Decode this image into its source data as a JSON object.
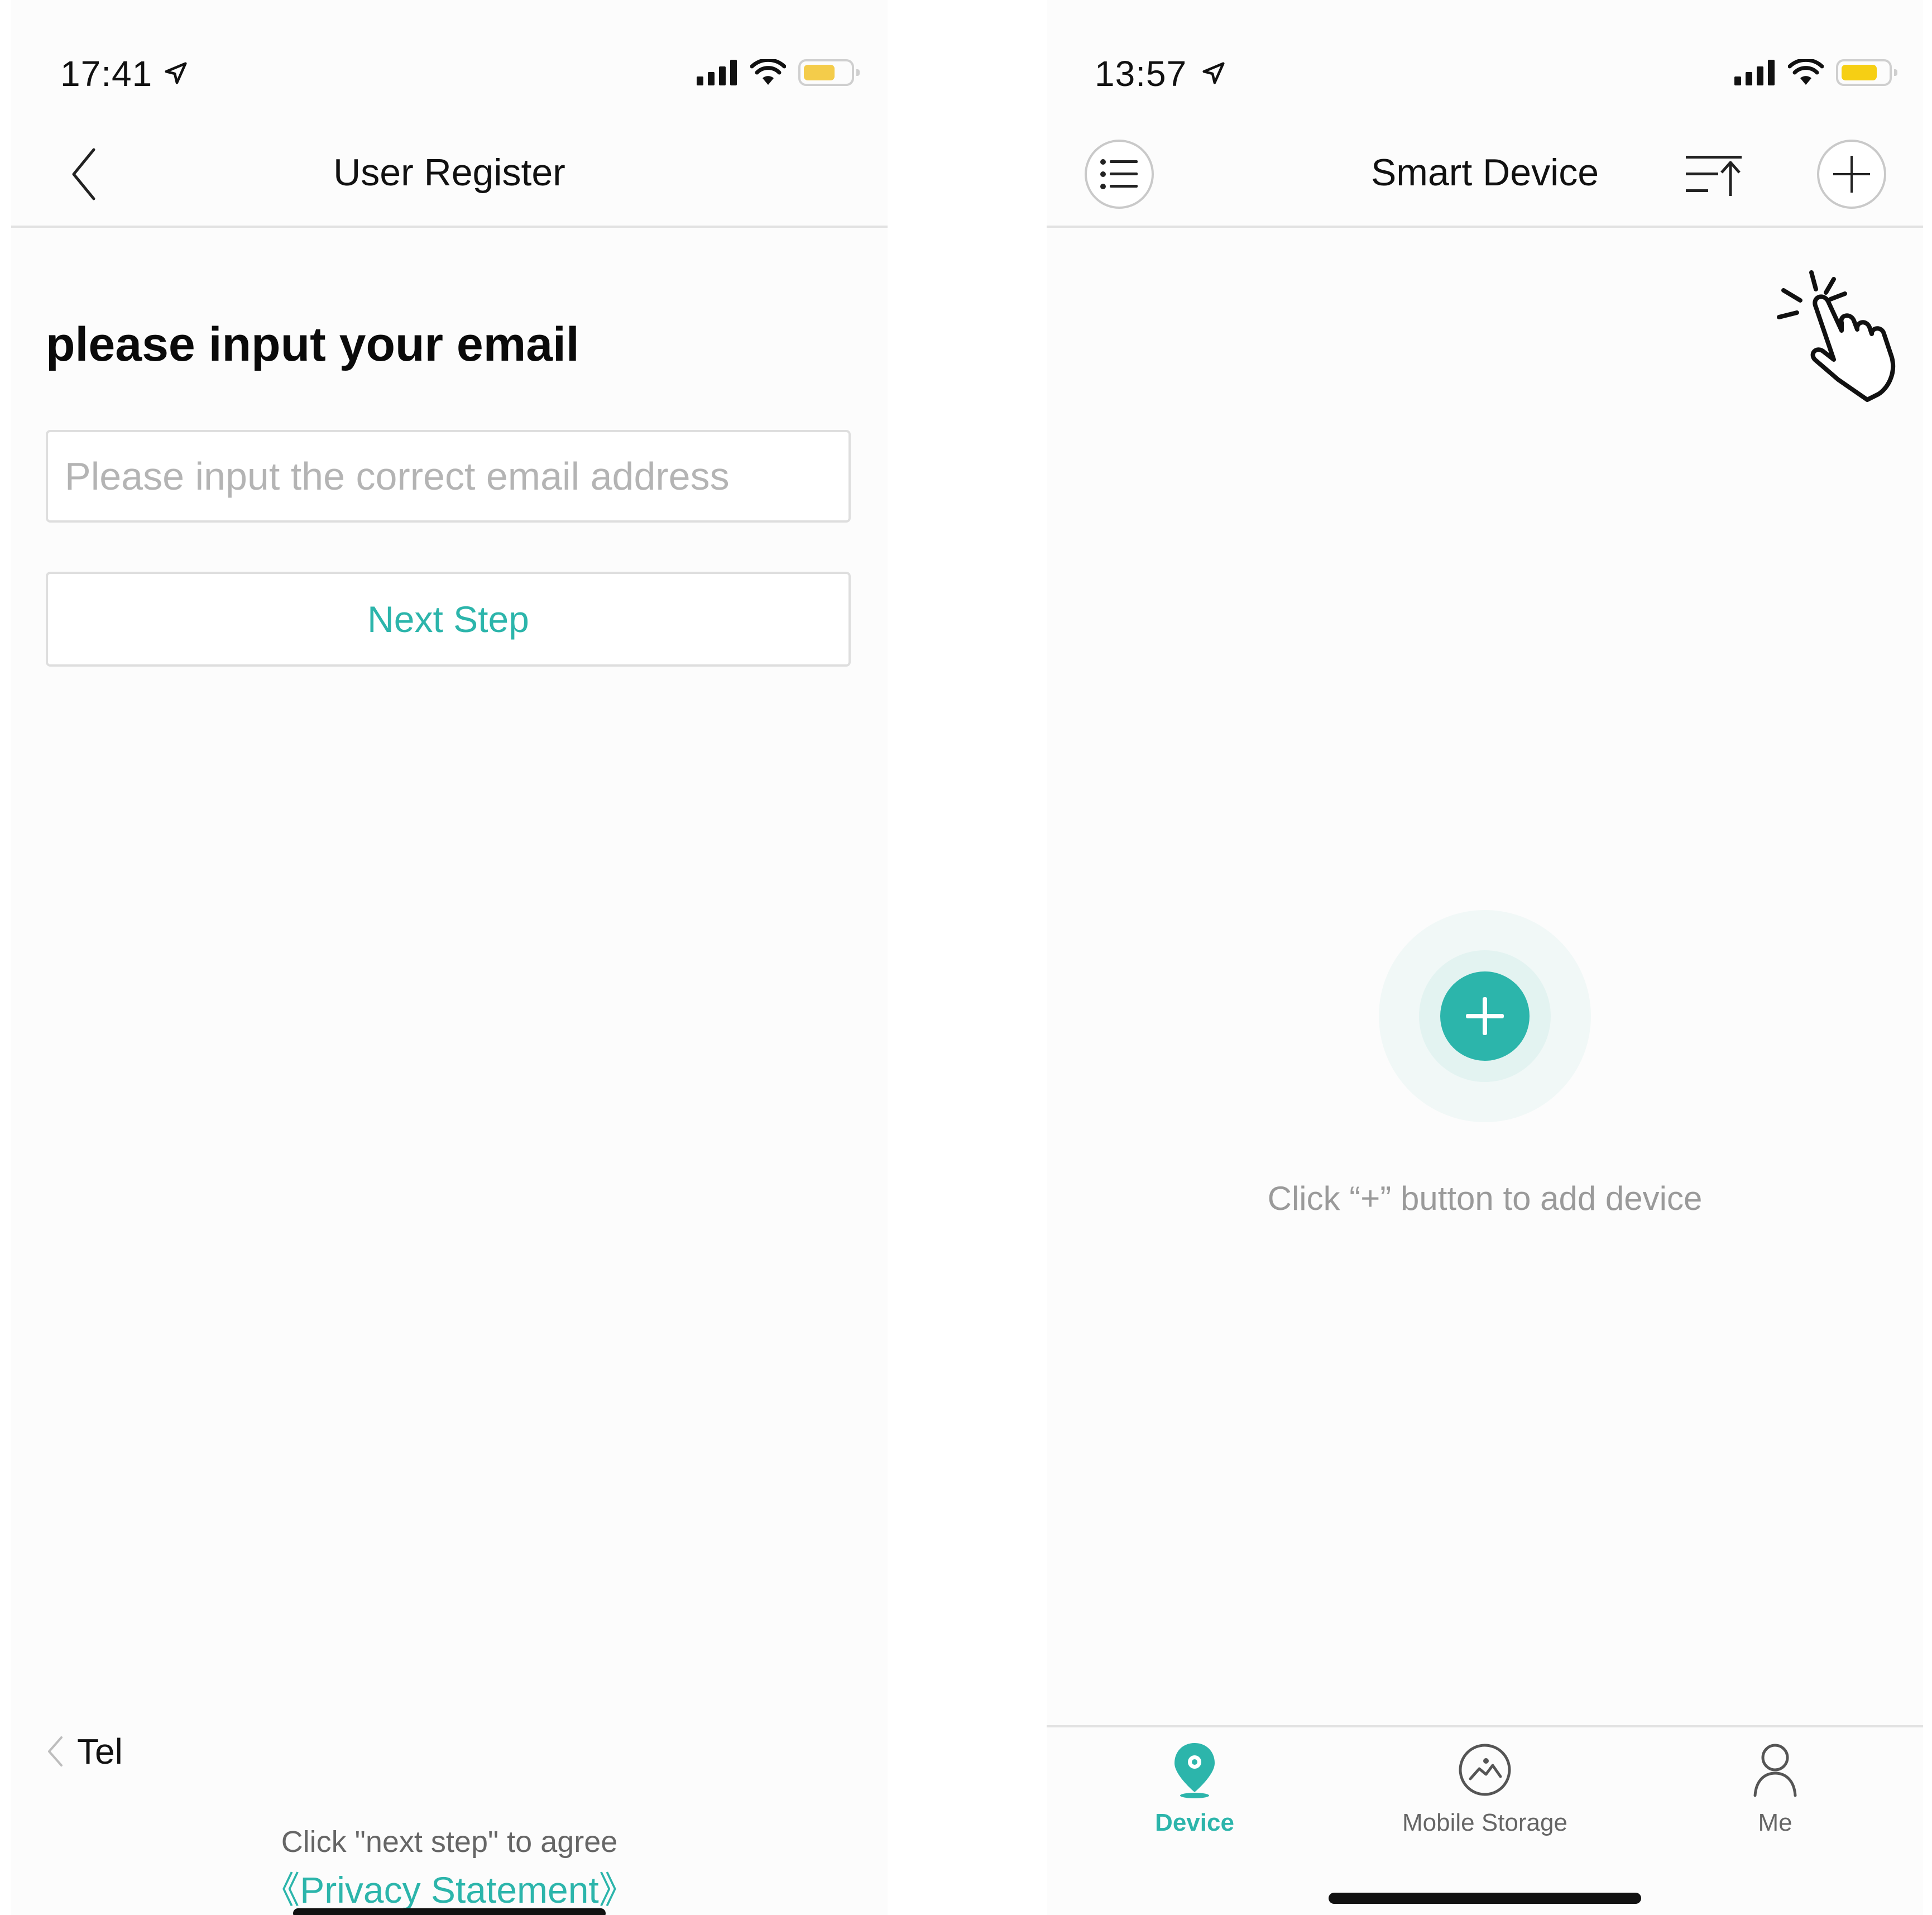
{
  "left": {
    "status": {
      "time": "17:41",
      "battery_color": "#f4cc4a"
    },
    "header": {
      "title": "User Register",
      "back_icon": "chevron-left-icon"
    },
    "form": {
      "heading": "please input your email",
      "email_placeholder": "Please input the correct email address",
      "next_label": "Next Step"
    },
    "footer": {
      "tel_label": "Tel",
      "agree_text": "Click \"next step\" to agree",
      "privacy_link": "《Privacy Statement》"
    }
  },
  "right": {
    "status": {
      "time": "13:57",
      "battery_color": "#f6cf14"
    },
    "header": {
      "title": "Smart Device",
      "menu_icon": "list-icon",
      "sort_icon": "sort-icon",
      "add_icon": "plus-icon"
    },
    "empty_state": {
      "hint": "Click “+” button to add device"
    },
    "tabs": [
      {
        "label": "Device",
        "icon": "location-pin-icon",
        "active": true
      },
      {
        "label": "Mobile Storage",
        "icon": "image-icon",
        "active": false
      },
      {
        "label": "Me",
        "icon": "person-icon",
        "active": false
      }
    ]
  },
  "colors": {
    "accent": "#2cb5ab",
    "divider": "#e2e2e2"
  }
}
